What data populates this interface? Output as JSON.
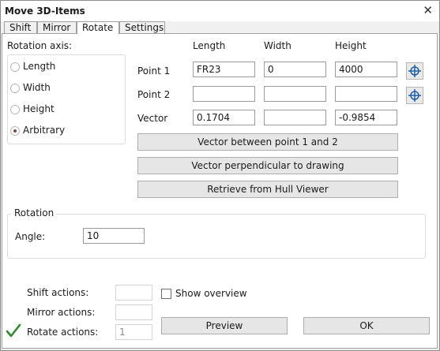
{
  "window": {
    "title": "Move 3D-Items",
    "close_glyph": "✕"
  },
  "tabs": [
    {
      "label": "Shift",
      "active": false
    },
    {
      "label": "Mirror",
      "active": false
    },
    {
      "label": "Rotate",
      "active": true
    },
    {
      "label": "Settings",
      "active": false
    }
  ],
  "rotation_axis": {
    "label": "Rotation axis:",
    "options": [
      {
        "label": "Length",
        "checked": false
      },
      {
        "label": "Width",
        "checked": false
      },
      {
        "label": "Height",
        "checked": false
      },
      {
        "label": "Arbitrary",
        "checked": true
      }
    ]
  },
  "grid": {
    "columns": [
      "Length",
      "Width",
      "Height"
    ],
    "rows": [
      {
        "label": "Point 1",
        "values": [
          "FR23",
          "0",
          "4000"
        ],
        "has_pick": true
      },
      {
        "label": "Point 2",
        "values": [
          "",
          "",
          ""
        ],
        "has_pick": true
      },
      {
        "label": "Vector",
        "values": [
          "0.1704",
          "",
          "-0.9854"
        ],
        "has_pick": false
      }
    ]
  },
  "buttons": {
    "vector_between": "Vector between point 1 and 2",
    "vector_perpendicular": "Vector perpendicular to drawing",
    "retrieve_hull": "Retrieve from Hull Viewer",
    "preview": "Preview",
    "ok": "OK"
  },
  "rotation": {
    "group_label": "Rotation",
    "angle_label": "Angle:",
    "angle_value": "10"
  },
  "actions": {
    "shift_label": "Shift actions:",
    "shift_value": "",
    "mirror_label": "Mirror actions:",
    "mirror_value": "",
    "rotate_label": "Rotate actions:",
    "rotate_value": "1",
    "rotate_done_icon": "checkmark-icon"
  },
  "show_overview": {
    "label": "Show overview",
    "checked": false
  },
  "colors": {
    "checkmark": "#2e8b2e",
    "pick_icon": "#1f5fa8"
  }
}
